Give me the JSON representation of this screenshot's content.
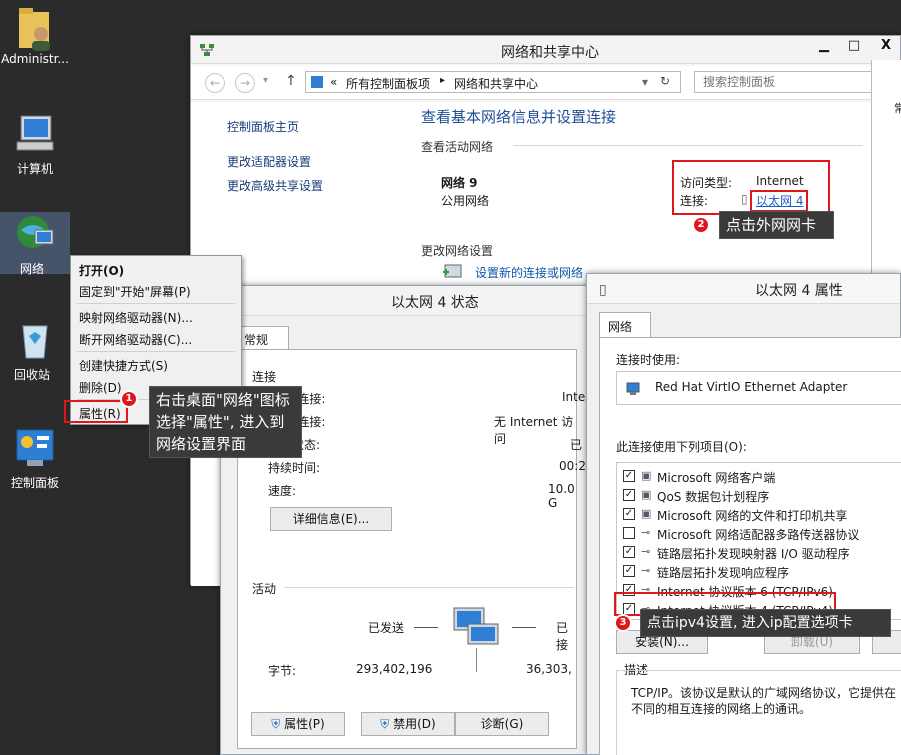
{
  "desktop": {
    "icons": [
      {
        "label": "Administr..."
      },
      {
        "label": "计算机"
      },
      {
        "label": "网络"
      },
      {
        "label": "回收站"
      },
      {
        "label": "控制面板"
      }
    ]
  },
  "context_menu": {
    "items": [
      "打开(O)",
      "固定到\"开始\"屏幕(P)",
      "映射网络驱动器(N)...",
      "断开网络驱动器(C)...",
      "创建快捷方式(S)",
      "删除(D)",
      "属性(R)"
    ]
  },
  "nsc": {
    "title": "网络和共享中心",
    "controls": {
      "minimize": "▁",
      "maximize": "□",
      "close": "X"
    },
    "address": {
      "prefix": "«",
      "crumb1": "所有控制面板项",
      "sep": "▸",
      "crumb2": "网络和共享中心"
    },
    "search_placeholder": "搜索控制面板",
    "sidebar": [
      "控制面板主页",
      "更改适配器设置",
      "更改高级共享设置"
    ],
    "heading": "查看基本网络信息并设置连接",
    "active_label": "查看活动网络",
    "network_name": "网络 9",
    "network_type": "公用网络",
    "access_label": "访问类型:",
    "access_value": "Internet",
    "conn_label": "连接:",
    "conn_value": "以太网 4",
    "change_label": "更改网络设置",
    "new_conn_link": "设置新的连接或网络"
  },
  "status": {
    "title": "以太网 4 状态",
    "tab": "常规",
    "section_conn": "连接",
    "rows": [
      {
        "label": "IPv4 连接:",
        "value": "Inte"
      },
      {
        "label": "IPv6 连接:",
        "value": "无 Internet 访问"
      },
      {
        "label": "媒体状态:",
        "value": "已"
      },
      {
        "label": "持续时间:",
        "value": "00:2"
      },
      {
        "label": "速度:",
        "value": "10.0 G"
      }
    ],
    "details_btn": "详细信息(E)...",
    "section_activity": "活动",
    "sent_label": "已发送",
    "recv_label": "已接",
    "bytes_label": "字节:",
    "bytes_sent": "293,402,196",
    "bytes_recv": "36,303,",
    "btn_props": "属性(P)",
    "btn_disable": "禁用(D)",
    "btn_diag": "诊断(G)"
  },
  "props": {
    "title": "以太网 4 属性",
    "tab": "网络",
    "connect_using_label": "连接时使用:",
    "adapter": "Red Hat VirtIO Ethernet Adapter",
    "items_label": "此连接使用下列项目(O):",
    "items": [
      {
        "label": "Microsoft 网络客户端",
        "checked": true
      },
      {
        "label": "QoS 数据包计划程序",
        "checked": true
      },
      {
        "label": "Microsoft 网络的文件和打印机共享",
        "checked": true
      },
      {
        "label": "Microsoft 网络适配器多路传送器协议",
        "checked": false
      },
      {
        "label": "链路层拓扑发现映射器 I/O 驱动程序",
        "checked": true
      },
      {
        "label": "链路层拓扑发现响应程序",
        "checked": true
      },
      {
        "label": "Internet 协议版本 6 (TCP/IPv6)",
        "checked": true
      },
      {
        "label": "Internet 协议版本 4 (TCP/IPv4)",
        "checked": true
      }
    ],
    "install_btn": "安装(N)...",
    "uninstall_btn": "卸载(U)",
    "desc_label": "描述",
    "desc_text": "TCP/IP。该协议是默认的广域网络协议，它提供在不同的相互连接的网络上的通讯。"
  },
  "annotations": {
    "one": {
      "num": "1",
      "text": "右击桌面\"网络\"图标选择\"属性\", 进入到网络设置界面"
    },
    "two": {
      "num": "2",
      "text": "点击外网网卡"
    },
    "three": {
      "num": "3",
      "text": "点击ipv4设置, 进入ip配置选项卡"
    }
  },
  "right_panel": {
    "text": "常"
  }
}
